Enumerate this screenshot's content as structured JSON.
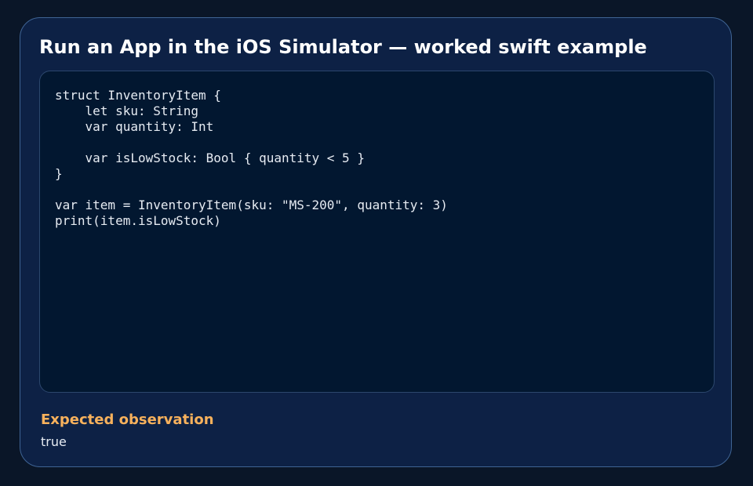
{
  "card": {
    "title": "Run an App in the iOS Simulator — worked swift example"
  },
  "code": {
    "language": "swift",
    "text": "struct InventoryItem {\n    let sku: String\n    var quantity: Int\n\n    var isLowStock: Bool { quantity < 5 }\n}\n\nvar item = InventoryItem(sku: \"MS-200\", quantity: 3)\nprint(item.isLowStock)"
  },
  "observation": {
    "heading": "Expected observation",
    "value": "true"
  },
  "colors": {
    "page_background": "#0a1628",
    "card_background": "#0d2145",
    "card_border": "#3f6494",
    "code_background": "#021730",
    "accent_heading": "#f7b15c",
    "text": "#e6ebf2"
  }
}
